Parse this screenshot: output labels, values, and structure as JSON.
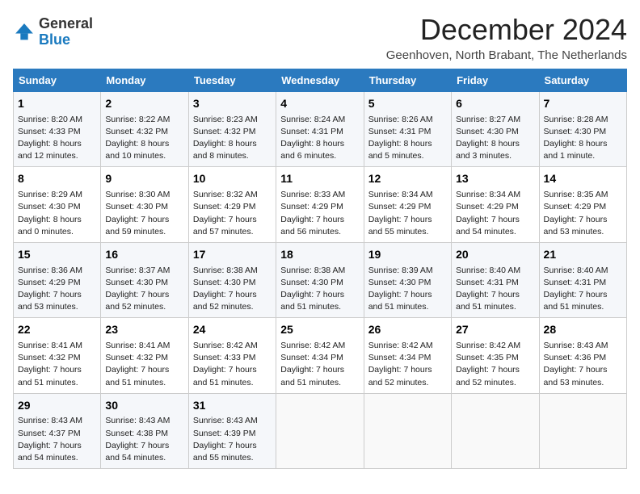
{
  "header": {
    "logo": {
      "line1": "General",
      "line2": "Blue"
    },
    "title": "December 2024",
    "subtitle": "Geenhoven, North Brabant, The Netherlands"
  },
  "days_of_week": [
    "Sunday",
    "Monday",
    "Tuesday",
    "Wednesday",
    "Thursday",
    "Friday",
    "Saturday"
  ],
  "weeks": [
    [
      {
        "day": "1",
        "sunrise": "8:20 AM",
        "sunset": "4:33 PM",
        "daylight": "8 hours and 12 minutes."
      },
      {
        "day": "2",
        "sunrise": "8:22 AM",
        "sunset": "4:32 PM",
        "daylight": "8 hours and 10 minutes."
      },
      {
        "day": "3",
        "sunrise": "8:23 AM",
        "sunset": "4:32 PM",
        "daylight": "8 hours and 8 minutes."
      },
      {
        "day": "4",
        "sunrise": "8:24 AM",
        "sunset": "4:31 PM",
        "daylight": "8 hours and 6 minutes."
      },
      {
        "day": "5",
        "sunrise": "8:26 AM",
        "sunset": "4:31 PM",
        "daylight": "8 hours and 5 minutes."
      },
      {
        "day": "6",
        "sunrise": "8:27 AM",
        "sunset": "4:30 PM",
        "daylight": "8 hours and 3 minutes."
      },
      {
        "day": "7",
        "sunrise": "8:28 AM",
        "sunset": "4:30 PM",
        "daylight": "8 hours and 1 minute."
      }
    ],
    [
      {
        "day": "8",
        "sunrise": "8:29 AM",
        "sunset": "4:30 PM",
        "daylight": "8 hours and 0 minutes."
      },
      {
        "day": "9",
        "sunrise": "8:30 AM",
        "sunset": "4:30 PM",
        "daylight": "7 hours and 59 minutes."
      },
      {
        "day": "10",
        "sunrise": "8:32 AM",
        "sunset": "4:29 PM",
        "daylight": "7 hours and 57 minutes."
      },
      {
        "day": "11",
        "sunrise": "8:33 AM",
        "sunset": "4:29 PM",
        "daylight": "7 hours and 56 minutes."
      },
      {
        "day": "12",
        "sunrise": "8:34 AM",
        "sunset": "4:29 PM",
        "daylight": "7 hours and 55 minutes."
      },
      {
        "day": "13",
        "sunrise": "8:34 AM",
        "sunset": "4:29 PM",
        "daylight": "7 hours and 54 minutes."
      },
      {
        "day": "14",
        "sunrise": "8:35 AM",
        "sunset": "4:29 PM",
        "daylight": "7 hours and 53 minutes."
      }
    ],
    [
      {
        "day": "15",
        "sunrise": "8:36 AM",
        "sunset": "4:29 PM",
        "daylight": "7 hours and 53 minutes."
      },
      {
        "day": "16",
        "sunrise": "8:37 AM",
        "sunset": "4:30 PM",
        "daylight": "7 hours and 52 minutes."
      },
      {
        "day": "17",
        "sunrise": "8:38 AM",
        "sunset": "4:30 PM",
        "daylight": "7 hours and 52 minutes."
      },
      {
        "day": "18",
        "sunrise": "8:38 AM",
        "sunset": "4:30 PM",
        "daylight": "7 hours and 51 minutes."
      },
      {
        "day": "19",
        "sunrise": "8:39 AM",
        "sunset": "4:30 PM",
        "daylight": "7 hours and 51 minutes."
      },
      {
        "day": "20",
        "sunrise": "8:40 AM",
        "sunset": "4:31 PM",
        "daylight": "7 hours and 51 minutes."
      },
      {
        "day": "21",
        "sunrise": "8:40 AM",
        "sunset": "4:31 PM",
        "daylight": "7 hours and 51 minutes."
      }
    ],
    [
      {
        "day": "22",
        "sunrise": "8:41 AM",
        "sunset": "4:32 PM",
        "daylight": "7 hours and 51 minutes."
      },
      {
        "day": "23",
        "sunrise": "8:41 AM",
        "sunset": "4:32 PM",
        "daylight": "7 hours and 51 minutes."
      },
      {
        "day": "24",
        "sunrise": "8:42 AM",
        "sunset": "4:33 PM",
        "daylight": "7 hours and 51 minutes."
      },
      {
        "day": "25",
        "sunrise": "8:42 AM",
        "sunset": "4:34 PM",
        "daylight": "7 hours and 51 minutes."
      },
      {
        "day": "26",
        "sunrise": "8:42 AM",
        "sunset": "4:34 PM",
        "daylight": "7 hours and 52 minutes."
      },
      {
        "day": "27",
        "sunrise": "8:42 AM",
        "sunset": "4:35 PM",
        "daylight": "7 hours and 52 minutes."
      },
      {
        "day": "28",
        "sunrise": "8:43 AM",
        "sunset": "4:36 PM",
        "daylight": "7 hours and 53 minutes."
      }
    ],
    [
      {
        "day": "29",
        "sunrise": "8:43 AM",
        "sunset": "4:37 PM",
        "daylight": "7 hours and 54 minutes."
      },
      {
        "day": "30",
        "sunrise": "8:43 AM",
        "sunset": "4:38 PM",
        "daylight": "7 hours and 54 minutes."
      },
      {
        "day": "31",
        "sunrise": "8:43 AM",
        "sunset": "4:39 PM",
        "daylight": "7 hours and 55 minutes."
      },
      null,
      null,
      null,
      null
    ]
  ]
}
